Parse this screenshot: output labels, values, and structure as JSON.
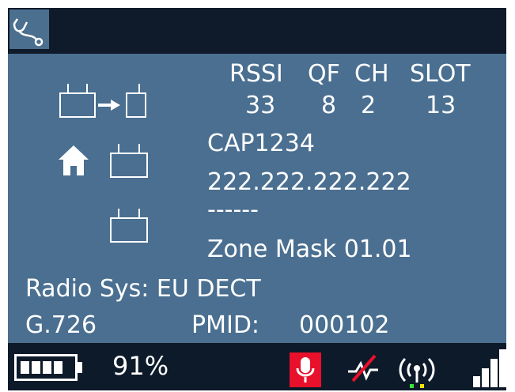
{
  "header": {
    "columns": [
      "RSSI",
      "QF",
      "CH",
      "SLOT"
    ],
    "values": [
      "33",
      "8",
      "2",
      "13"
    ]
  },
  "info": {
    "base_name": "CAP1234",
    "ip_address": "222.222.222.222",
    "placeholder_line": "------",
    "zone_mask": "Zone Mask 01.01",
    "radio_sys": "Radio Sys: EU DECT",
    "codec": "G.726",
    "pmid_label": "PMID:",
    "pmid_value": "000102"
  },
  "status": {
    "battery_percent_text": "91%",
    "battery_level": 0.91,
    "signal_bars_total": 4,
    "signal_bars_active": 4
  },
  "icons": {
    "top_left": "stethoscope-icon",
    "handover": "base-to-base-arrow-icon",
    "home": "home-icon",
    "home_base": "base-station-icon",
    "other_base": "base-station-icon",
    "battery": "battery-icon",
    "mic": "microphone-icon",
    "no_link": "link-off-icon",
    "antenna": "antenna-icon",
    "signal": "signal-strength-icon"
  },
  "colors": {
    "panel": "#4a6f90",
    "background": "#0d1a2a",
    "mic_bg": "#e8102a",
    "link_off_slash": "#e8102a",
    "antenna_green": "#39e639",
    "antenna_yellow": "#f2e600"
  }
}
